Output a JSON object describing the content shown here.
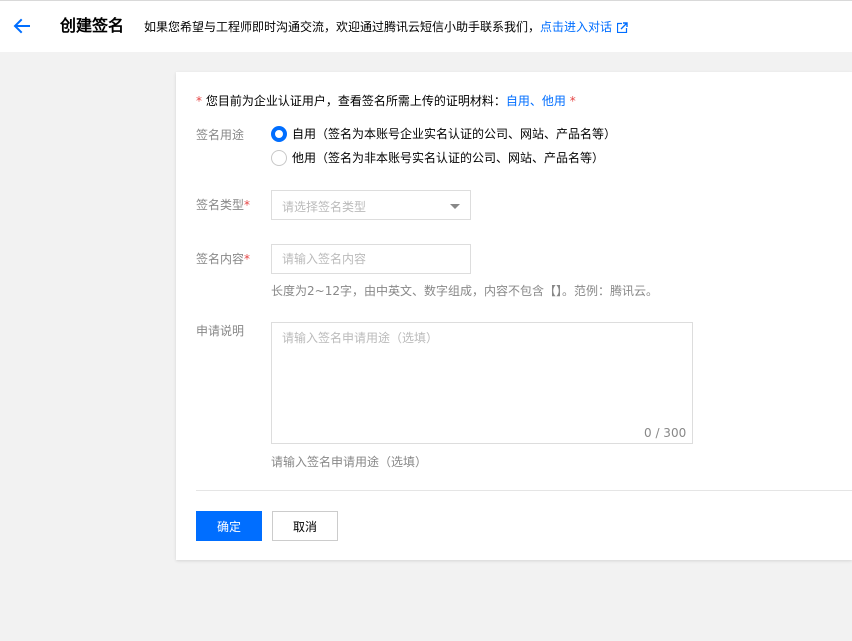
{
  "header": {
    "title": "创建签名",
    "tip": "如果您希望与工程师即时沟通交流，欢迎通过腾讯云短信小助手联系我们，",
    "link": "点击进入对话"
  },
  "notice": {
    "asterisk": "*",
    "text": "您目前为企业认证用户，查看签名所需上传的证明材料：",
    "link1": "自用",
    "sep": "、",
    "link2": "他用",
    "asterisk2": "*"
  },
  "form": {
    "usage_label": "签名用途",
    "usage_options": [
      {
        "label": "自用（签名为本账号企业实名认证的公司、网站、产品名等）",
        "checked": true
      },
      {
        "label": "他用（签名为非本账号实名认证的公司、网站、产品名等）",
        "checked": false
      }
    ],
    "type_label": "签名类型",
    "type_placeholder": "请选择签名类型",
    "content_label": "签名内容",
    "content_placeholder": "请输入签名内容",
    "content_hint": "长度为2~12字，由中英文、数字组成，内容不包含【】。范例：腾讯云。",
    "desc_label": "申请说明",
    "desc_placeholder": "请输入签名申请用途（选填）",
    "desc_counter": "0 / 300",
    "desc_hint": "请输入签名申请用途（选填）",
    "required_mark": "*"
  },
  "buttons": {
    "confirm": "确定",
    "cancel": "取消"
  },
  "colors": {
    "accent": "#006eff",
    "required": "#e54545"
  }
}
